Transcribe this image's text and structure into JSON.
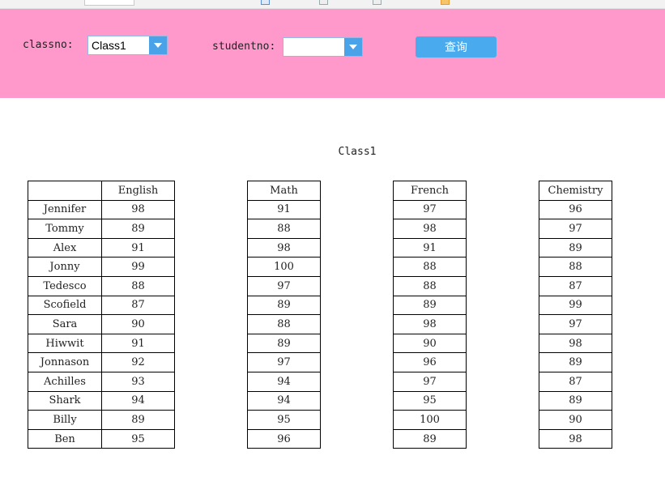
{
  "filter": {
    "classno_label": "classno:",
    "classno_value": "Class1",
    "studentno_label": "studentno:",
    "studentno_value": "",
    "query_label": "查询"
  },
  "class_title": "Class1",
  "students": [
    "Jennifer",
    "Tommy",
    "Alex",
    "Jonny",
    "Tedesco",
    "Scofield",
    "Sara",
    "Hiwwit",
    "Jonnason",
    "Achilles",
    "Shark",
    "Billy",
    "Ben"
  ],
  "subjects": [
    {
      "name": "English",
      "scores": [
        "98",
        "89",
        "91",
        "99",
        "88",
        "87",
        "90",
        "91",
        "92",
        "93",
        "94",
        "89",
        "95"
      ]
    },
    {
      "name": "Math",
      "scores": [
        "91",
        "88",
        "98",
        "100",
        "97",
        "89",
        "88",
        "89",
        "97",
        "94",
        "94",
        "95",
        "96"
      ]
    },
    {
      "name": "French",
      "scores": [
        "97",
        "98",
        "91",
        "88",
        "88",
        "89",
        "98",
        "90",
        "96",
        "97",
        "95",
        "100",
        "89"
      ]
    },
    {
      "name": "Chemistry",
      "scores": [
        "96",
        "97",
        "89",
        "88",
        "87",
        "99",
        "97",
        "98",
        "89",
        "87",
        "89",
        "90",
        "98"
      ]
    }
  ],
  "colors": {
    "panel": "#ff99cc",
    "accent": "#4aa3e8"
  }
}
